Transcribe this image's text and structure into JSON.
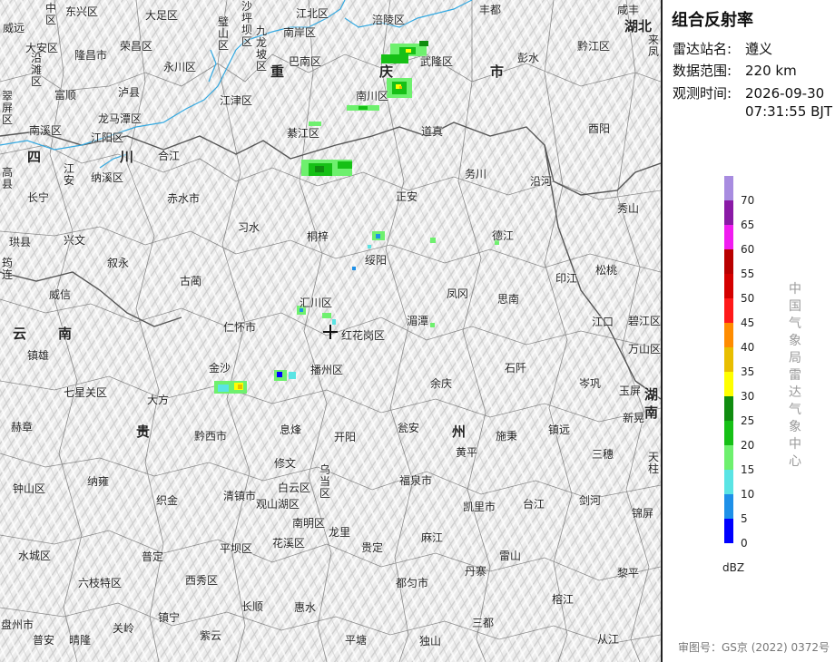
{
  "panel": {
    "title": "组合反射率",
    "station_label": "雷达站名:",
    "station_value": "遵义",
    "range_label": "数据范围:",
    "range_value": "220 km",
    "time_label": "观测时间:",
    "time_date": "2026-09-30",
    "time_clock": "07:31:55 BJT",
    "legend_unit": "dBZ",
    "legend_levels": [
      {
        "label": "70",
        "color": "#a88ce0"
      },
      {
        "label": "65",
        "color": "#8a1aa6"
      },
      {
        "label": "60",
        "color": "#f01cf0"
      },
      {
        "label": "55",
        "color": "#b80000"
      },
      {
        "label": "50",
        "color": "#d40000"
      },
      {
        "label": "45",
        "color": "#ff1a1a"
      },
      {
        "label": "40",
        "color": "#ff8c00"
      },
      {
        "label": "35",
        "color": "#e8be00"
      },
      {
        "label": "30",
        "color": "#ffff00"
      },
      {
        "label": "25",
        "color": "#108c10"
      },
      {
        "label": "20",
        "color": "#16c016"
      },
      {
        "label": "15",
        "color": "#6ef06e"
      },
      {
        "label": "10",
        "color": "#5ae4e4"
      },
      {
        "label": "5",
        "color": "#1e90e8"
      },
      {
        "label": "0",
        "color": "#0000ff"
      }
    ],
    "org_text": "中国气象局雷达气象中心",
    "approval": "审图号：GS京 (2022) 0372号"
  },
  "map": {
    "radar_station_marker": "crosshair-icon",
    "provinces": [
      {
        "id": "p1",
        "text": "重"
      },
      {
        "id": "p2",
        "text": "庆"
      },
      {
        "id": "p3",
        "text": "市"
      },
      {
        "id": "p4",
        "text": "四"
      },
      {
        "id": "p5",
        "text": "川"
      },
      {
        "id": "p6",
        "text": "云"
      },
      {
        "id": "p7",
        "text": "南"
      },
      {
        "id": "p8",
        "text": "贵"
      },
      {
        "id": "p9",
        "text": "州"
      },
      {
        "id": "p10",
        "text": "湖北"
      },
      {
        "id": "p11",
        "text": "湖"
      },
      {
        "id": "p12",
        "text": "南"
      }
    ],
    "places": [
      {
        "id": "c1",
        "text": "中区"
      },
      {
        "id": "c2",
        "text": "东兴区"
      },
      {
        "id": "c3",
        "text": "威远"
      },
      {
        "id": "c4",
        "text": "大安区"
      },
      {
        "id": "c5",
        "text": "沿滩区"
      },
      {
        "id": "c6",
        "text": "隆昌市"
      },
      {
        "id": "c7",
        "text": "荣昌区"
      },
      {
        "id": "c8",
        "text": "大足区"
      },
      {
        "id": "c9",
        "text": "永川区"
      },
      {
        "id": "c10",
        "text": "璧山区"
      },
      {
        "id": "c11",
        "text": "沙坪坝区"
      },
      {
        "id": "c12",
        "text": "九龙坡区"
      },
      {
        "id": "c13",
        "text": "江北区"
      },
      {
        "id": "c14",
        "text": "南岸区"
      },
      {
        "id": "c15",
        "text": "巴南区"
      },
      {
        "id": "c16",
        "text": "涪陵区"
      },
      {
        "id": "c17",
        "text": "丰都"
      },
      {
        "id": "c18",
        "text": "武隆区"
      },
      {
        "id": "c19",
        "text": "彭水"
      },
      {
        "id": "c20",
        "text": "黔江区"
      },
      {
        "id": "c21",
        "text": "咸丰"
      },
      {
        "id": "c22",
        "text": "来凤"
      },
      {
        "id": "c23",
        "text": "富顺"
      },
      {
        "id": "c24",
        "text": "泸县"
      },
      {
        "id": "c25",
        "text": "龙马潭区"
      },
      {
        "id": "c26",
        "text": "江阳区"
      },
      {
        "id": "c27",
        "text": "江津区"
      },
      {
        "id": "c28",
        "text": "南川区"
      },
      {
        "id": "c29",
        "text": "綦江区"
      },
      {
        "id": "c30",
        "text": "道真"
      },
      {
        "id": "c31",
        "text": "酉阳"
      },
      {
        "id": "c32",
        "text": "翠屏区"
      },
      {
        "id": "c33",
        "text": "南溪区"
      },
      {
        "id": "c34",
        "text": "江安"
      },
      {
        "id": "c35",
        "text": "纳溪区"
      },
      {
        "id": "c36",
        "text": "合江"
      },
      {
        "id": "c37",
        "text": "高县"
      },
      {
        "id": "c38",
        "text": "长宁"
      },
      {
        "id": "c39",
        "text": "赤水市"
      },
      {
        "id": "c40",
        "text": "务川"
      },
      {
        "id": "c41",
        "text": "沿河"
      },
      {
        "id": "c42",
        "text": "正安"
      },
      {
        "id": "c43",
        "text": "习水"
      },
      {
        "id": "c44",
        "text": "桐梓"
      },
      {
        "id": "c45",
        "text": "德江"
      },
      {
        "id": "c46",
        "text": "秀山"
      },
      {
        "id": "c47",
        "text": "珙县"
      },
      {
        "id": "c48",
        "text": "兴文"
      },
      {
        "id": "c49",
        "text": "叙永"
      },
      {
        "id": "c50",
        "text": "绥阳"
      },
      {
        "id": "c51",
        "text": "印江"
      },
      {
        "id": "c52",
        "text": "松桃"
      },
      {
        "id": "c53",
        "text": "筠连"
      },
      {
        "id": "c54",
        "text": "古蔺"
      },
      {
        "id": "c55",
        "text": "凤冈"
      },
      {
        "id": "c56",
        "text": "思南"
      },
      {
        "id": "c57",
        "text": "威信"
      },
      {
        "id": "c58",
        "text": "汇川区"
      },
      {
        "id": "c59",
        "text": "湄潭"
      },
      {
        "id": "c60",
        "text": "江口"
      },
      {
        "id": "c61",
        "text": "碧江区"
      },
      {
        "id": "c62",
        "text": "仁怀市"
      },
      {
        "id": "c63",
        "text": "红花岗区"
      },
      {
        "id": "c64",
        "text": "万山区"
      },
      {
        "id": "c65",
        "text": "镇雄"
      },
      {
        "id": "c66",
        "text": "金沙"
      },
      {
        "id": "c67",
        "text": "播州区"
      },
      {
        "id": "c68",
        "text": "石阡"
      },
      {
        "id": "c69",
        "text": "七星关区"
      },
      {
        "id": "c70",
        "text": "大方"
      },
      {
        "id": "c71",
        "text": "余庆"
      },
      {
        "id": "c72",
        "text": "岑巩"
      },
      {
        "id": "c73",
        "text": "玉屏"
      },
      {
        "id": "c74",
        "text": "新晃"
      },
      {
        "id": "c75",
        "text": "赫章"
      },
      {
        "id": "c76",
        "text": "黔西市"
      },
      {
        "id": "c77",
        "text": "息烽"
      },
      {
        "id": "c78",
        "text": "开阳"
      },
      {
        "id": "c79",
        "text": "瓮安"
      },
      {
        "id": "c80",
        "text": "施秉"
      },
      {
        "id": "c81",
        "text": "镇远"
      },
      {
        "id": "c82",
        "text": "黄平"
      },
      {
        "id": "c83",
        "text": "三穗"
      },
      {
        "id": "c84",
        "text": "天柱"
      },
      {
        "id": "c85",
        "text": "修文"
      },
      {
        "id": "c86",
        "text": "乌当区"
      },
      {
        "id": "c87",
        "text": "纳雍"
      },
      {
        "id": "c88",
        "text": "白云区"
      },
      {
        "id": "c89",
        "text": "福泉市"
      },
      {
        "id": "c90",
        "text": "钟山区"
      },
      {
        "id": "c91",
        "text": "织金"
      },
      {
        "id": "c92",
        "text": "清镇市"
      },
      {
        "id": "c93",
        "text": "观山湖区"
      },
      {
        "id": "c94",
        "text": "凯里市"
      },
      {
        "id": "c95",
        "text": "台江"
      },
      {
        "id": "c96",
        "text": "剑河"
      },
      {
        "id": "c97",
        "text": "南明区"
      },
      {
        "id": "c98",
        "text": "龙里"
      },
      {
        "id": "c99",
        "text": "锦屏"
      },
      {
        "id": "c100",
        "text": "麻江"
      },
      {
        "id": "c101",
        "text": "平坝区"
      },
      {
        "id": "c102",
        "text": "花溪区"
      },
      {
        "id": "c103",
        "text": "贵定"
      },
      {
        "id": "c104",
        "text": "水城区"
      },
      {
        "id": "c105",
        "text": "普定"
      },
      {
        "id": "c106",
        "text": "丹寨"
      },
      {
        "id": "c107",
        "text": "雷山"
      },
      {
        "id": "c108",
        "text": "黎平"
      },
      {
        "id": "c109",
        "text": "六枝特区"
      },
      {
        "id": "c110",
        "text": "西秀区"
      },
      {
        "id": "c111",
        "text": "都匀市"
      },
      {
        "id": "c112",
        "text": "榕江"
      },
      {
        "id": "c113",
        "text": "长顺"
      },
      {
        "id": "c114",
        "text": "惠水"
      },
      {
        "id": "c115",
        "text": "镇宁"
      },
      {
        "id": "c116",
        "text": "盘州市"
      },
      {
        "id": "c117",
        "text": "关岭"
      },
      {
        "id": "c118",
        "text": "三都"
      },
      {
        "id": "c119",
        "text": "普安"
      },
      {
        "id": "c120",
        "text": "晴隆"
      },
      {
        "id": "c121",
        "text": "紫云"
      },
      {
        "id": "c122",
        "text": "平塘"
      },
      {
        "id": "c123",
        "text": "独山"
      },
      {
        "id": "c124",
        "text": "从江"
      }
    ]
  }
}
